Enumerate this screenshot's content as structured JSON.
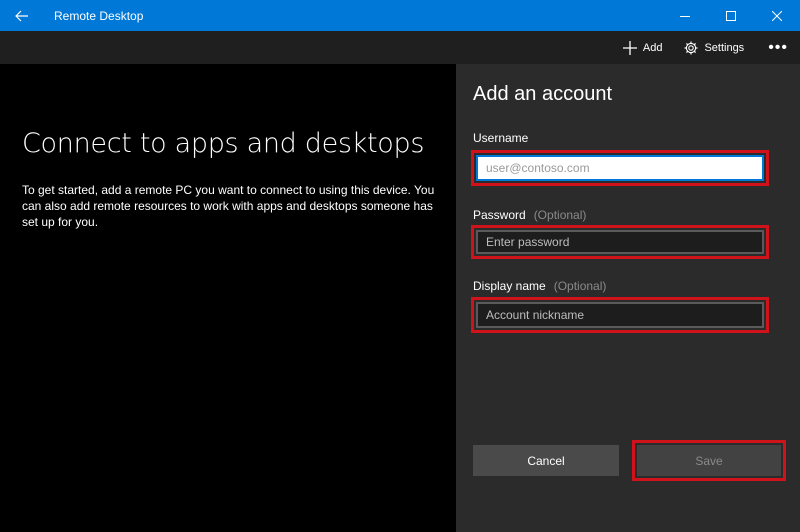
{
  "window": {
    "title": "Remote Desktop",
    "accent_color": "#0078d7"
  },
  "toolbar": {
    "add_label": "Add",
    "settings_label": "Settings",
    "more_label": "•••"
  },
  "welcome": {
    "heading": "Connect to apps and desktops",
    "body": "To get started, add a remote PC you want to connect to using this device. You can also add remote resources to work with apps and desktops someone has set up for you."
  },
  "account_form": {
    "title": "Add an account",
    "username": {
      "label": "Username",
      "placeholder": "user@contoso.com",
      "value": ""
    },
    "password": {
      "label": "Password",
      "optional": "(Optional)",
      "placeholder": "Enter password",
      "value": ""
    },
    "display_name": {
      "label": "Display name",
      "optional": "(Optional)",
      "placeholder": "Account nickname",
      "value": ""
    },
    "cancel_label": "Cancel",
    "save_label": "Save",
    "highlight_color": "#d0121b"
  }
}
